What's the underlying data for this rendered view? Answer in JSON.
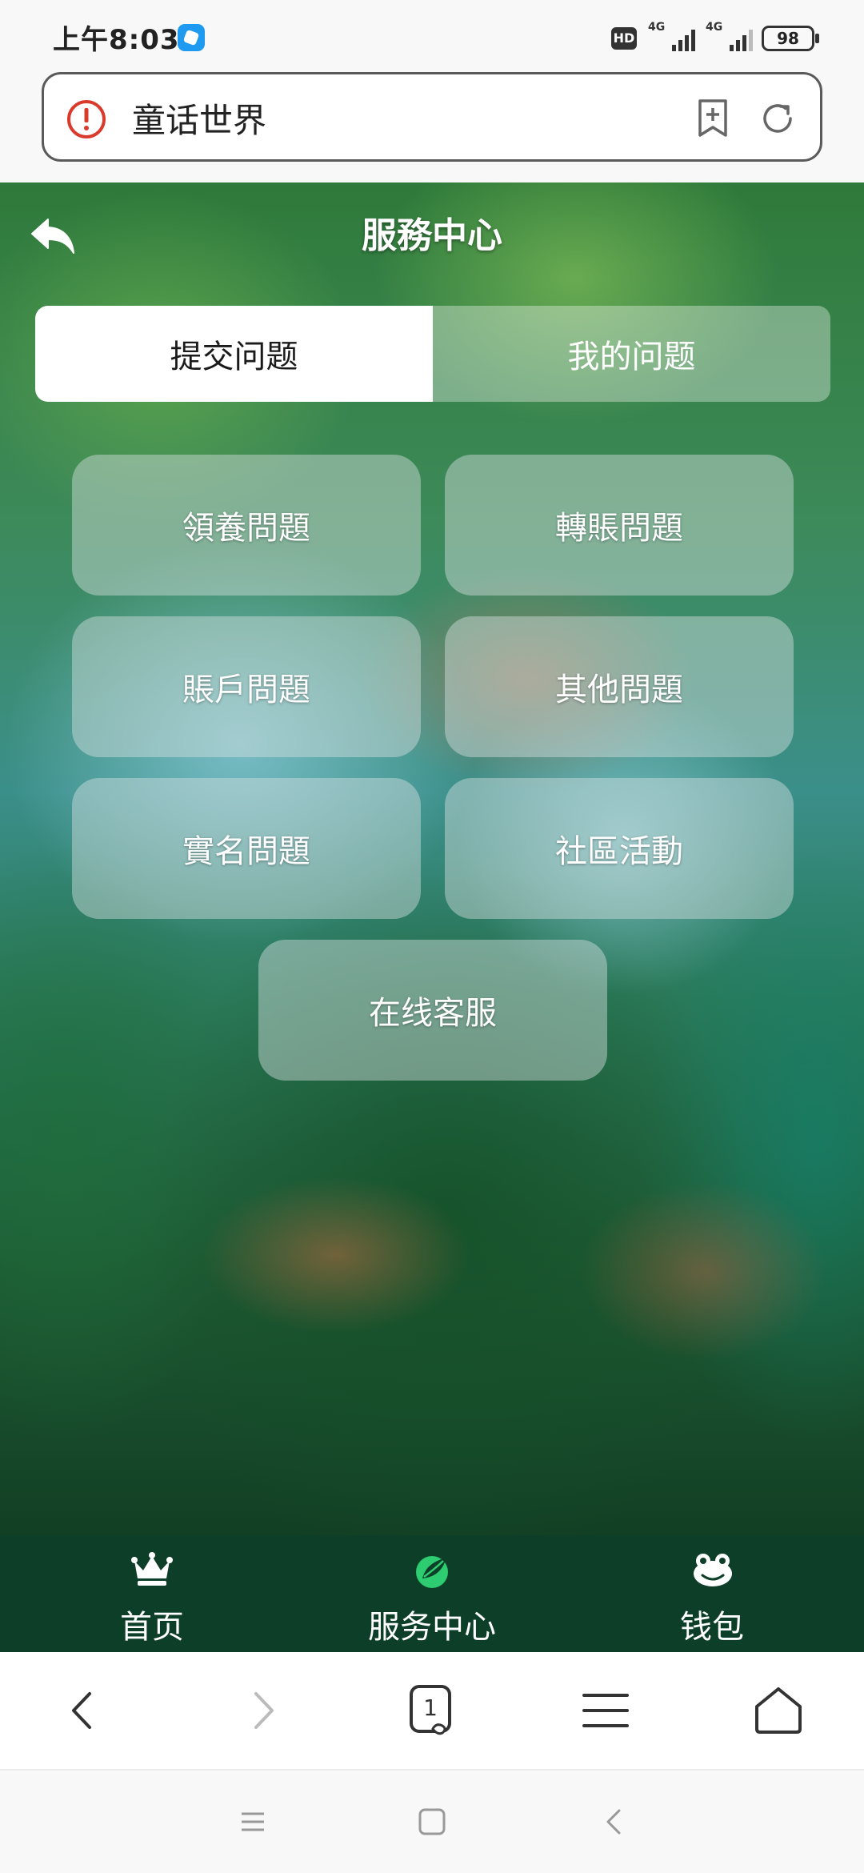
{
  "status_bar": {
    "time": "上午8:03",
    "hd": "HD",
    "network_1": "4G",
    "network_2": "4G",
    "battery": "98"
  },
  "browser": {
    "url_text": "童话世界",
    "icons": {
      "warning": "warning-icon",
      "bookmark": "add-bookmark-icon",
      "reload": "reload-icon"
    },
    "tab_count": "1"
  },
  "page": {
    "title": "服務中心",
    "tabs": [
      {
        "label": "提交问题",
        "active": true
      },
      {
        "label": "我的问题",
        "active": false
      }
    ],
    "categories": [
      {
        "label": "領養問題"
      },
      {
        "label": "轉賬問題"
      },
      {
        "label": "賬戶問題"
      },
      {
        "label": "其他問題"
      },
      {
        "label": "實名問題"
      },
      {
        "label": "社區活動"
      },
      {
        "label": "在线客服"
      }
    ]
  },
  "app_nav": {
    "items": [
      {
        "label": "首页",
        "icon": "crown-icon"
      },
      {
        "label": "服务中心",
        "icon": "leaf-icon"
      },
      {
        "label": "钱包",
        "icon": "frog-icon"
      }
    ]
  },
  "colors": {
    "nav_bg": "#0d3e27",
    "accent_green": "#2ecc71",
    "warning_red": "#d93a2b"
  }
}
